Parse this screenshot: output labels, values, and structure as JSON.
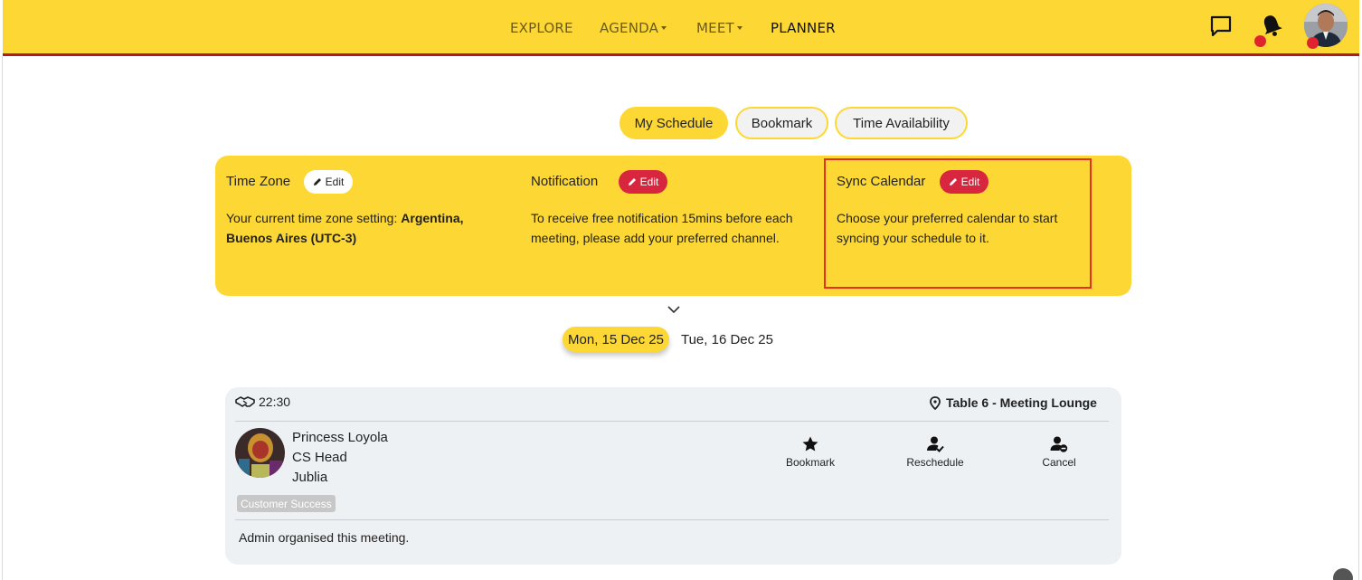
{
  "nav": {
    "items": [
      {
        "label": "EXPLORE",
        "has_caret": false,
        "active": false
      },
      {
        "label": "AGENDA",
        "has_caret": true,
        "active": false
      },
      {
        "label": "MEET",
        "has_caret": true,
        "active": false
      },
      {
        "label": "PLANNER",
        "has_caret": false,
        "active": true
      }
    ],
    "icons": [
      "chat-icon",
      "bell-icon",
      "avatar"
    ],
    "colors": {
      "bar": "#fdd835",
      "underline": "#b01c1c",
      "badge": "#e0242f"
    }
  },
  "tabs": [
    {
      "label": "My Schedule",
      "active": true
    },
    {
      "label": "Bookmark",
      "active": false
    },
    {
      "label": "Time Availability",
      "active": false
    }
  ],
  "settings": {
    "timezone": {
      "title": "Time Zone",
      "edit_label": "Edit",
      "text_prefix": "Your current time zone setting: ",
      "text_bold": "Argentina, Buenos Aires (UTC-3)"
    },
    "notification": {
      "title": "Notification",
      "edit_label": "Edit",
      "text": "To receive free notification 15mins before each meeting, please add your preferred channel."
    },
    "sync_calendar": {
      "title": "Sync Calendar",
      "edit_label": "Edit",
      "text": "Choose your preferred calendar to start syncing your schedule to it."
    }
  },
  "dates": [
    {
      "label": "Mon, 15 Dec 25",
      "active": true
    },
    {
      "label": "Tue, 16 Dec 25",
      "active": false
    }
  ],
  "meeting": {
    "time": "22:30",
    "location": "Table 6 - Meeting Lounge",
    "person": {
      "name": "Princess Loyola",
      "title": "CS Head",
      "company": "Jublia",
      "tag": "Customer Success"
    },
    "actions": [
      {
        "label": "Bookmark",
        "icon": "star-icon"
      },
      {
        "label": "Reschedule",
        "icon": "user-check-icon"
      },
      {
        "label": "Cancel",
        "icon": "user-minus-icon"
      }
    ],
    "footer": "Admin organised this meeting."
  }
}
